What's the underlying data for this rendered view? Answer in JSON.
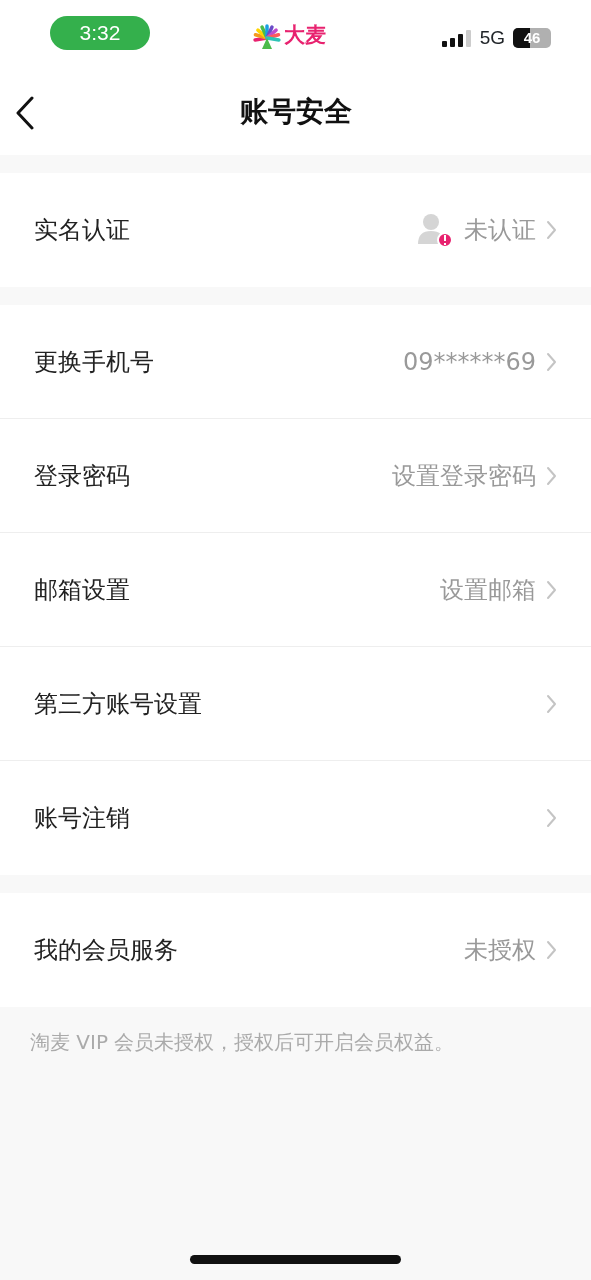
{
  "status_bar": {
    "time": "3:32",
    "app_name": "大麦",
    "network": "5G",
    "battery": "46"
  },
  "nav": {
    "title": "账号安全"
  },
  "groups": [
    {
      "items": [
        {
          "kind": "status",
          "label": "实名认证",
          "value": "未认证"
        }
      ]
    },
    {
      "items": [
        {
          "kind": "value",
          "label": "更换手机号",
          "value": "09******69"
        },
        {
          "kind": "value",
          "label": "登录密码",
          "value": "设置登录密码"
        },
        {
          "kind": "value",
          "label": "邮箱设置",
          "value": "设置邮箱"
        },
        {
          "kind": "link",
          "label": "第三方账号设置"
        },
        {
          "kind": "link",
          "label": "账号注销"
        }
      ]
    },
    {
      "items": [
        {
          "kind": "value",
          "label": "我的会员服务",
          "value": "未授权"
        }
      ]
    }
  ],
  "note": "淘麦 VIP 会员未授权，授权后可开启会员权益。"
}
